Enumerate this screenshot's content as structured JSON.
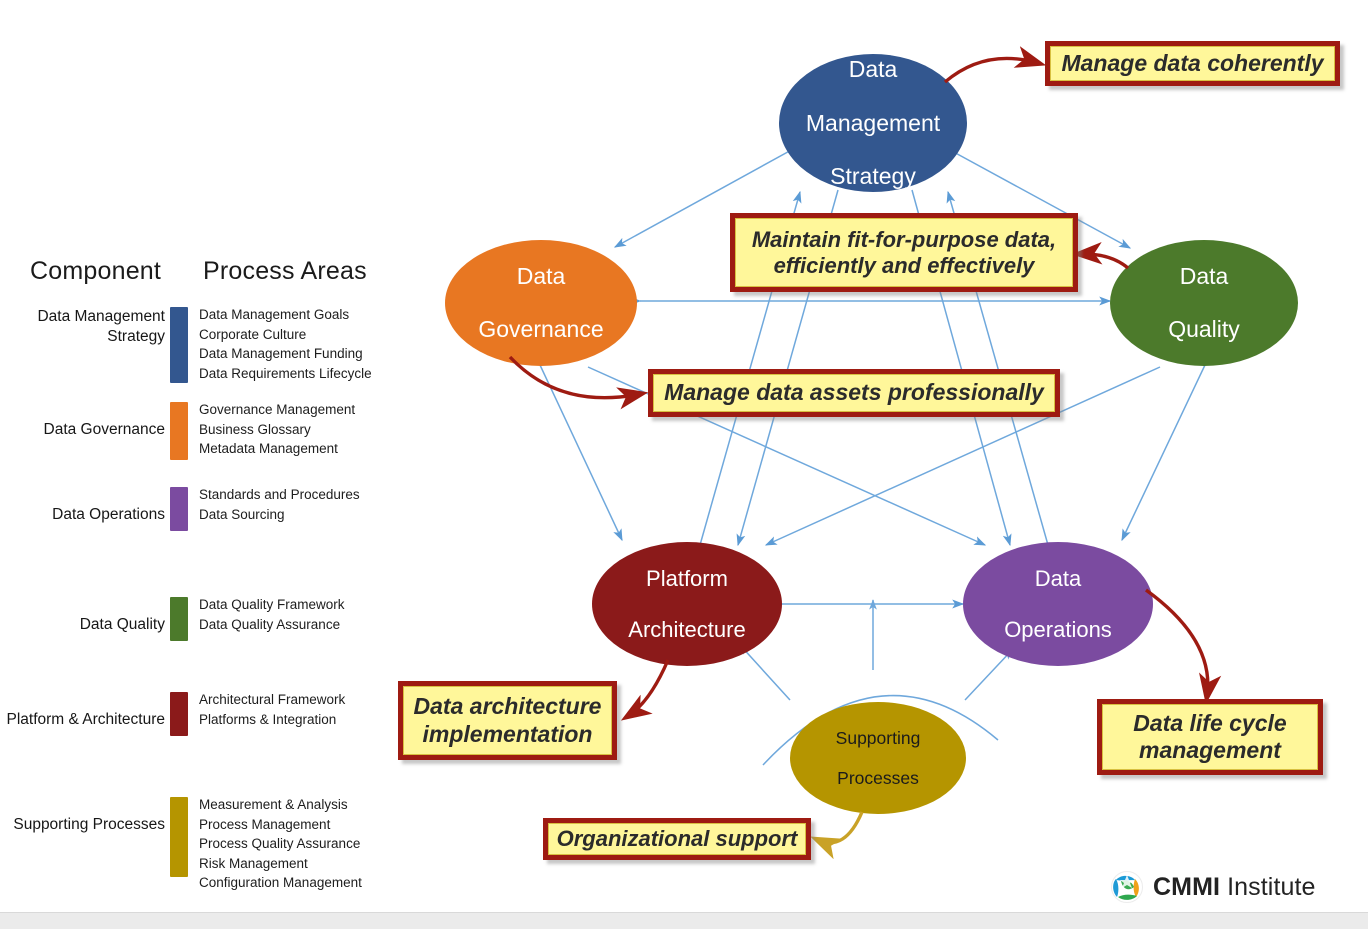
{
  "legend": {
    "header_component": "Component",
    "header_process_areas": "Process Areas",
    "rows": [
      {
        "component": "Data Management Strategy",
        "color": "#33578F",
        "areas": [
          "Data Management Goals",
          "Corporate Culture",
          "Data Management Funding",
          "Data Requirements Lifecycle"
        ]
      },
      {
        "component": "Data Governance",
        "color": "#E87722",
        "areas": [
          "Governance Management",
          "Business Glossary",
          "Metadata  Management"
        ]
      },
      {
        "component": "Data Operations",
        "color": "#7B4BA0",
        "areas": [
          "Standards and Procedures",
          "Data Sourcing"
        ]
      },
      {
        "component": "Data Quality",
        "color": "#4C7A2B",
        "areas": [
          "Data Quality Framework",
          "Data Quality Assurance"
        ]
      },
      {
        "component": "Platform & Architecture",
        "color": "#8B1A1A",
        "areas": [
          "Architectural Framework",
          "Platforms & Integration"
        ]
      },
      {
        "component": "Supporting Processes",
        "color": "#B59500",
        "areas": [
          "Measurement & Analysis",
          "Process Management",
          "Process Quality Assurance",
          "Risk Management",
          "Configuration Management"
        ]
      }
    ]
  },
  "diagram": {
    "nodes": [
      {
        "id": "data-management-strategy",
        "label": "Data Management Strategy",
        "color": "#33578F",
        "text_color": "#ffffff"
      },
      {
        "id": "data-governance",
        "label": "Data Governance",
        "color": "#E87722",
        "text_color": "#ffffff"
      },
      {
        "id": "data-quality",
        "label": "Data Quality",
        "color": "#4C7A2B",
        "text_color": "#ffffff"
      },
      {
        "id": "platform-architecture",
        "label": "Platform Architecture",
        "color": "#8B1A1A",
        "text_color": "#ffffff"
      },
      {
        "id": "data-operations",
        "label": "Data Operations",
        "color": "#7B4BA0",
        "text_color": "#ffffff"
      },
      {
        "id": "supporting-processes",
        "label": "Supporting Processes",
        "color": "#B59500",
        "text_color": "#1b1b1b"
      }
    ],
    "callouts": [
      {
        "id": "manage-data-coherently",
        "text": "Manage data coherently",
        "source": "data-management-strategy"
      },
      {
        "id": "maintain-fit-for-purpose",
        "text": "Maintain fit-for-purpose data, efficiently and effectively",
        "source": "data-quality"
      },
      {
        "id": "manage-data-assets",
        "text": "Manage data assets professionally",
        "source": "data-governance"
      },
      {
        "id": "data-architecture-implementation",
        "text": "Data architecture implementation",
        "source": "platform-architecture"
      },
      {
        "id": "data-life-cycle-management",
        "text": "Data life cycle management",
        "source": "data-operations"
      },
      {
        "id": "organizational-support",
        "text": "Organizational support",
        "source": "supporting-processes"
      }
    ],
    "node_labels": {
      "dms_l1": "Data",
      "dms_l2": "Management",
      "dms_l3": "Strategy",
      "dg_l1": "Data",
      "dg_l2": "Governance",
      "dq_l1": "Data",
      "dq_l2": "Quality",
      "pa_l1": "Platform",
      "pa_l2": "Architecture",
      "do_l1": "Data",
      "do_l2": "Operations",
      "sp_l1": "Supporting",
      "sp_l2": "Processes"
    },
    "callout_lines": {
      "coherently": "Manage data coherently",
      "fit1": "Maintain fit-for-purpose data,",
      "fit2": "efficiently and effectively",
      "assets": "Manage data assets professionally",
      "arch1": "Data architecture",
      "arch2": "implementation",
      "life1": "Data life cycle",
      "life2": "management",
      "org": "Organizational support"
    },
    "colors": {
      "connector": "#6FA8DC",
      "callout_border": "#9E1B12",
      "callout_fill": "#FFF79A",
      "red_arrow": "#9E1B12",
      "gold_arrow": "#C9A227"
    }
  },
  "branding": {
    "name_bold": "CMMI",
    "name_regular": " Institute"
  }
}
